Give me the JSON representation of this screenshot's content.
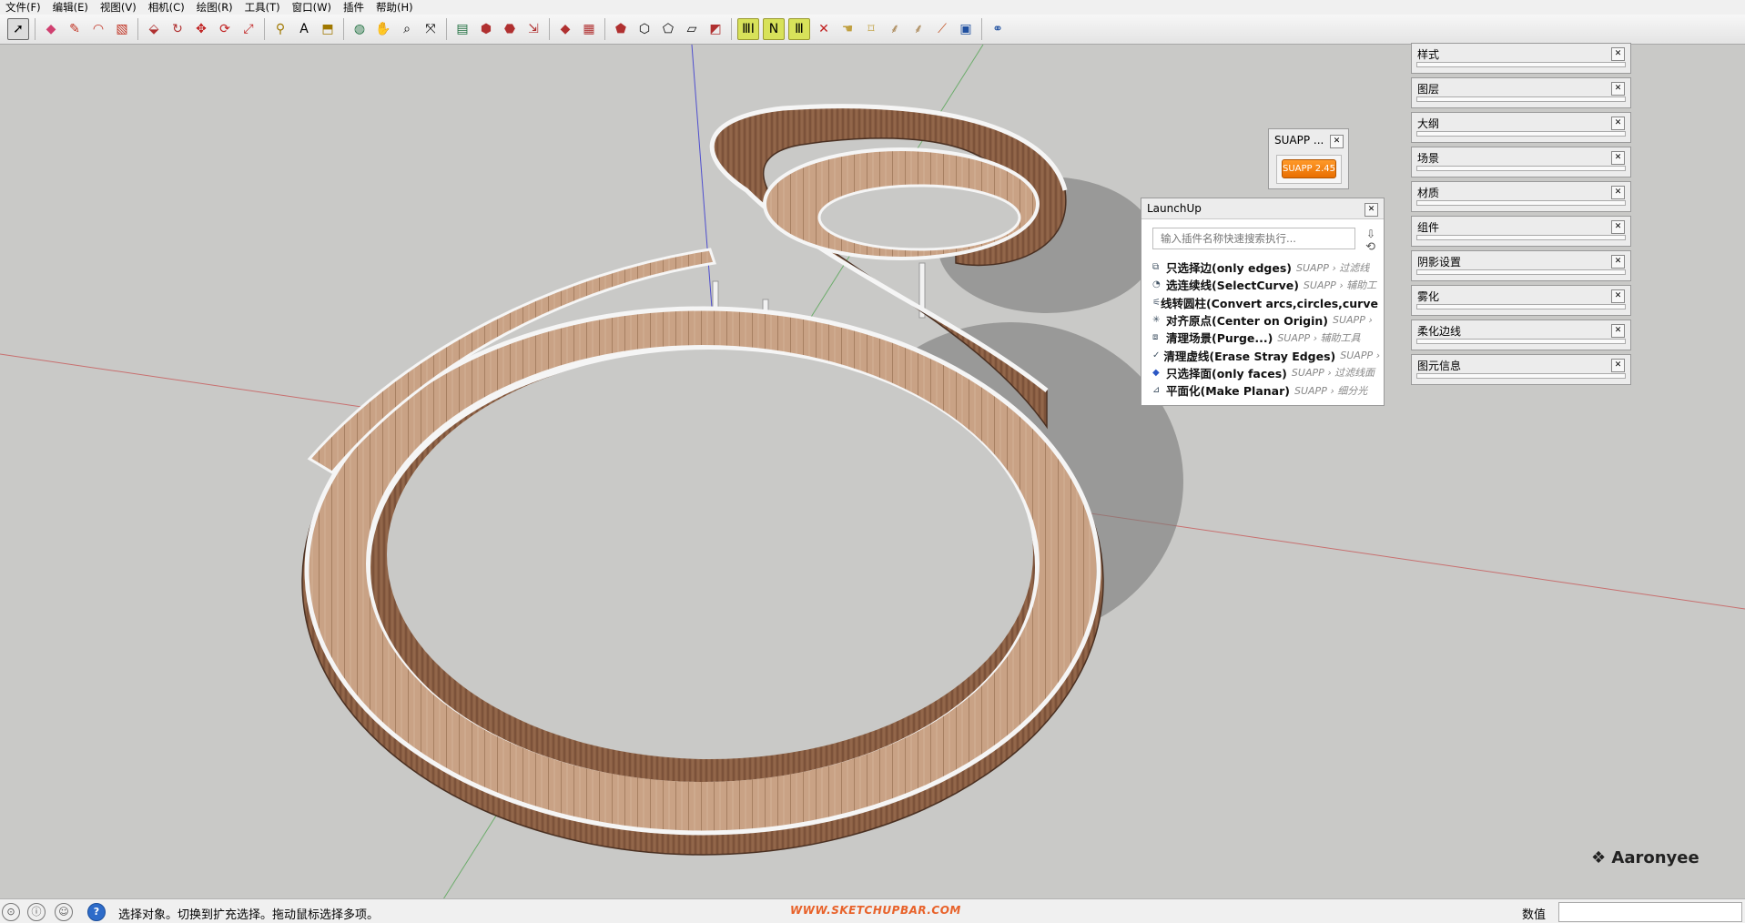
{
  "menu": [
    "文件(F)",
    "编辑(E)",
    "视图(V)",
    "相机(C)",
    "绘图(R)",
    "工具(T)",
    "窗口(W)",
    "插件",
    "帮助(H)"
  ],
  "tray": [
    {
      "label": "样式"
    },
    {
      "label": "图层"
    },
    {
      "label": "大纲"
    },
    {
      "label": "场景"
    },
    {
      "label": "材质"
    },
    {
      "label": "组件"
    },
    {
      "label": "阴影设置"
    },
    {
      "label": "雾化"
    },
    {
      "label": "柔化边线"
    },
    {
      "label": "图元信息"
    }
  ],
  "suapp": {
    "title": "SUAPP ...",
    "button": "SUAPP 2.45"
  },
  "launchup": {
    "title": "LaunchUp",
    "placeholder": "输入插件名称快速搜索执行...",
    "items": [
      {
        "name": "只选择边(only edges)",
        "path": "SUAPP › 过滤线"
      },
      {
        "name": "选连续线(SelectCurve)",
        "path": "SUAPP › 辅助工"
      },
      {
        "name": "线转圆柱(Convert arcs,circles,curve",
        "path": ""
      },
      {
        "name": "对齐原点(Center on Origin)",
        "path": "SUAPP ›"
      },
      {
        "name": "清理场景(Purge...)",
        "path": "SUAPP › 辅助工具"
      },
      {
        "name": "清理虚线(Erase Stray Edges)",
        "path": "SUAPP ›"
      },
      {
        "name": "只选择面(only faces)",
        "path": "SUAPP › 过滤线面"
      },
      {
        "name": "平面化(Make Planar)",
        "path": "SUAPP › 细分光"
      }
    ]
  },
  "status": {
    "message": "选择对象。切换到扩充选择。拖动鼠标选择多项。",
    "url": "WWW.SKETCHUPBAR.COM",
    "value_label": "数值"
  },
  "watermark": "Aaronyee",
  "colors": {
    "wood": "#8c5f45",
    "wood_light": "#c79f82",
    "axis_red": "#c83232",
    "axis_green": "#3aa03a",
    "axis_blue": "#2b2bd0"
  }
}
